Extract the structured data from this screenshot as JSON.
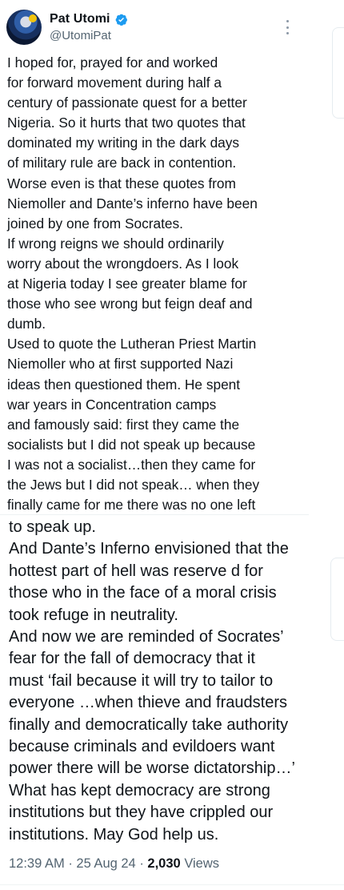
{
  "author": {
    "display_name": "Pat Utomi",
    "handle": "@UtomiPat",
    "verified_color": "#1d9bf0"
  },
  "tweet": {
    "upper_lines": [
      "I hoped for, prayed for and worked",
      "for forward movement during half a",
      "century of passionate quest for a better",
      "Nigeria. So it hurts that two quotes that",
      "dominated my writing in the dark days",
      "of military rule are back in contention.",
      "Worse even is that these quotes from",
      "Niemoller and Dante’s inferno have been",
      "joined by one from Socrates.",
      "If wrong reigns we should ordinarily",
      "worry about the wrongdoers. As I look",
      "at Nigeria today I see greater blame for",
      "those who see wrong but feign deaf and",
      "dumb.",
      "Used to quote the Lutheran Priest Martin",
      "Niemoller who at first supported Nazi",
      "ideas then questioned them. He spent",
      "war years in Concentration camps",
      "and famously said: first they came the",
      "socialists but I did not speak up because",
      "I was not a socialist…then they came for",
      "the Jews but I did not speak… when they",
      "finally came for me there was no one left"
    ],
    "lower_lines": [
      "to speak up.",
      "And Dante’s Inferno envisioned that the",
      "hottest part of hell was reserve d for",
      "those who in the face of a moral crisis",
      "took refuge in neutrality.",
      "And now we are reminded of Socrates’",
      "fear for the fall of democracy that it",
      "must ‘fail because it will try to tailor to",
      "everyone …when thieve and fraudsters",
      "finally and democratically take authority",
      "because criminals and evildoers want",
      "power there will be worse dictatorship…’",
      "What has kept democracy are strong",
      "institutions but they have crippled our",
      "institutions. May God help us."
    ]
  },
  "meta": {
    "time": "12:39 AM",
    "separator": "·",
    "date": "25 Aug 24",
    "views_count": "2,030",
    "views_label": "Views"
  },
  "icons": {
    "verified": "verified-badge-icon",
    "more": "more-options-icon"
  }
}
